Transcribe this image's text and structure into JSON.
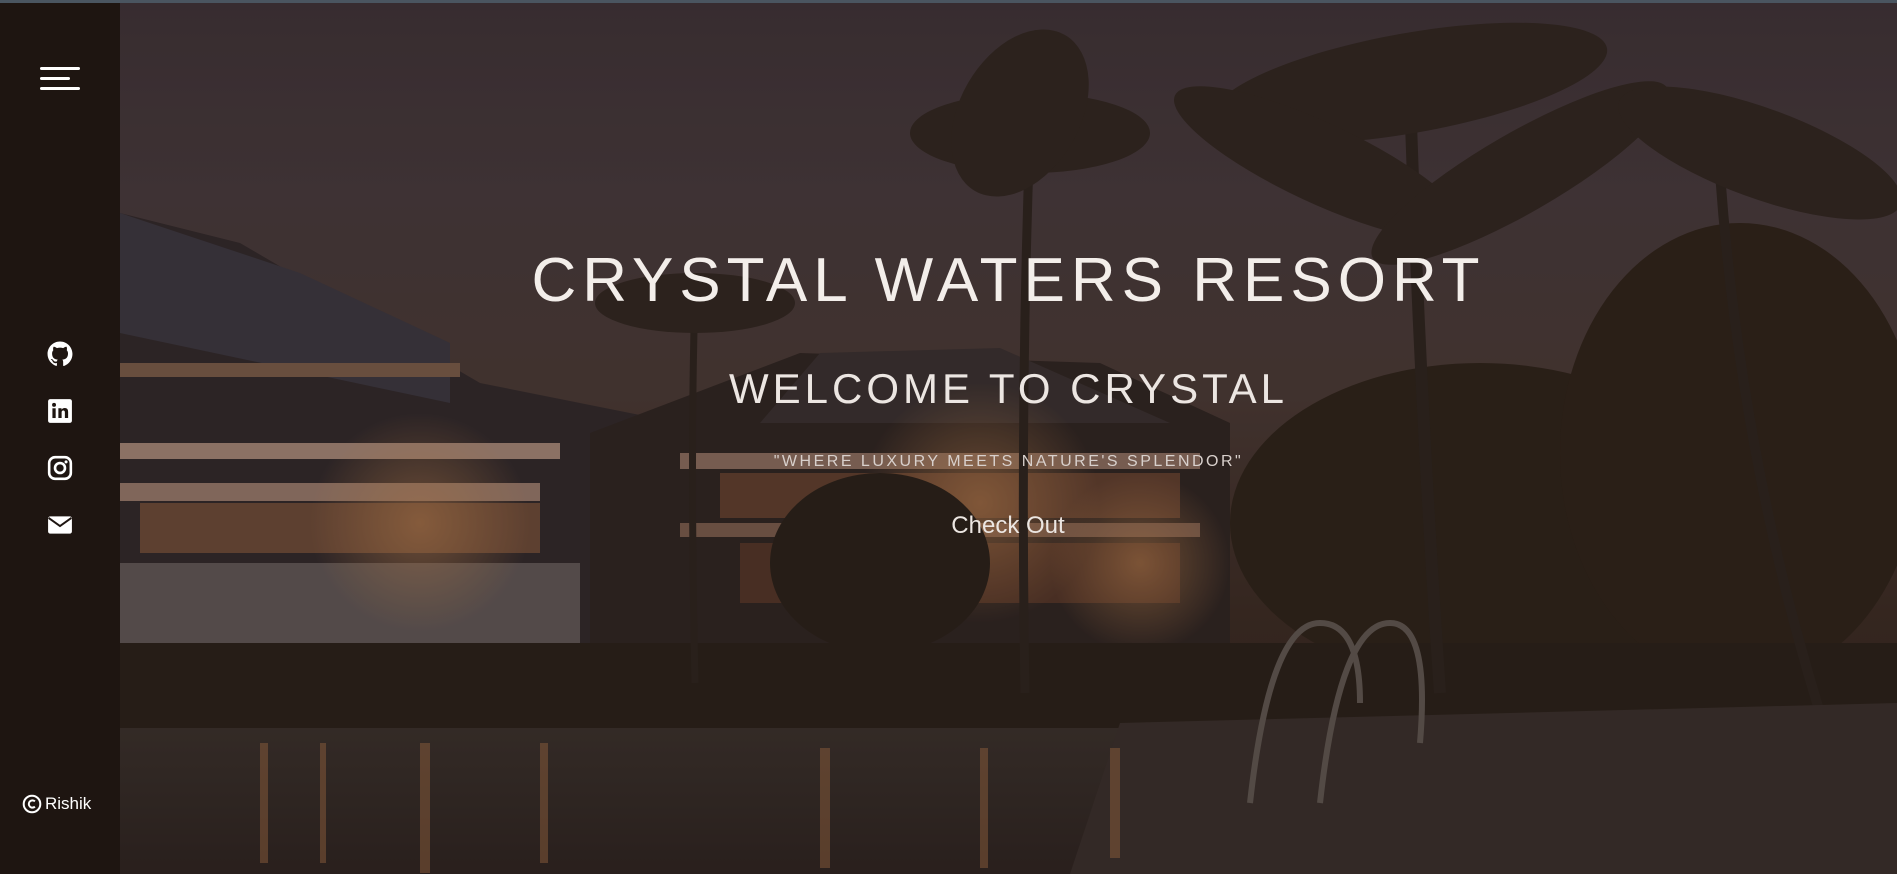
{
  "hero": {
    "title": "CRYSTAL WATERS RESORT",
    "subtitle": "WELCOME TO CRYSTAL",
    "tagline": "\"WHERE LUXURY MEETS NATURE'S SPLENDOR\"",
    "cta_label": "Check Out"
  },
  "sidebar": {
    "menu_icon": "hamburger-menu-icon",
    "socials": [
      {
        "name": "github",
        "icon": "github-icon"
      },
      {
        "name": "linkedin",
        "icon": "linkedin-icon"
      },
      {
        "name": "instagram",
        "icon": "instagram-icon"
      },
      {
        "name": "email",
        "icon": "envelope-icon"
      }
    ],
    "credit": {
      "icon": "copyright-icon",
      "name": "Rishik"
    }
  },
  "colors": {
    "sidebar_bg": "#1e1511",
    "icon": "#ffffff",
    "text": "#f3eeea"
  }
}
